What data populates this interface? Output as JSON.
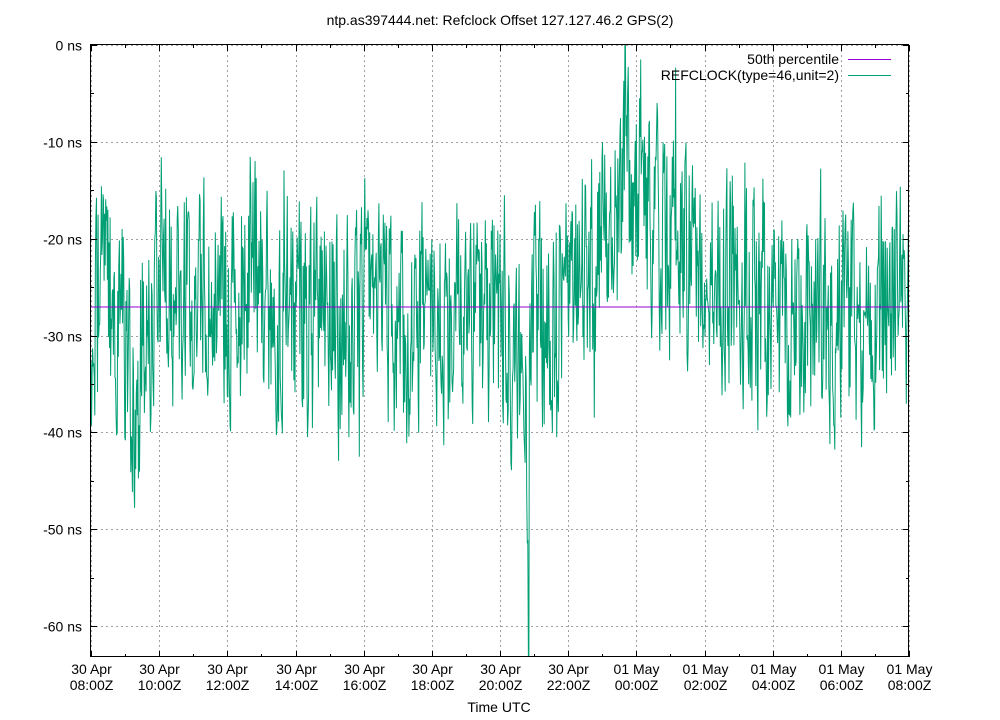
{
  "chart_data": {
    "type": "line",
    "title": "ntp.as397444.net: Refclock Offset 127.127.46.2 GPS(2)",
    "xlabel": "Time UTC",
    "ylabel": "",
    "ylim": [
      -63.2,
      0
    ],
    "xlim": [
      "2024-04-30T08:00Z",
      "2024-05-01T08:00Z"
    ],
    "grid": true,
    "legend_position": "top-right",
    "y_ticks": [
      {
        "value": 0,
        "label": "0 ns"
      },
      {
        "value": -10,
        "label": "-10 ns"
      },
      {
        "value": -20,
        "label": "-20 ns"
      },
      {
        "value": -30,
        "label": "-30 ns"
      },
      {
        "value": -40,
        "label": "-40 ns"
      },
      {
        "value": -50,
        "label": "-50 ns"
      },
      {
        "value": -60,
        "label": "-60 ns"
      }
    ],
    "x_ticks": [
      {
        "time": "2024-04-30T08:00Z",
        "line1": "30 Apr",
        "line2": "08:00Z"
      },
      {
        "time": "2024-04-30T10:00Z",
        "line1": "30 Apr",
        "line2": "10:00Z"
      },
      {
        "time": "2024-04-30T12:00Z",
        "line1": "30 Apr",
        "line2": "12:00Z"
      },
      {
        "time": "2024-04-30T14:00Z",
        "line1": "30 Apr",
        "line2": "14:00Z"
      },
      {
        "time": "2024-04-30T16:00Z",
        "line1": "30 Apr",
        "line2": "16:00Z"
      },
      {
        "time": "2024-04-30T18:00Z",
        "line1": "30 Apr",
        "line2": "18:00Z"
      },
      {
        "time": "2024-04-30T20:00Z",
        "line1": "30 Apr",
        "line2": "20:00Z"
      },
      {
        "time": "2024-04-30T22:00Z",
        "line1": "30 Apr",
        "line2": "22:00Z"
      },
      {
        "time": "2024-05-01T00:00Z",
        "line1": "01 May",
        "line2": "00:00Z"
      },
      {
        "time": "2024-05-01T02:00Z",
        "line1": "01 May",
        "line2": "02:00Z"
      },
      {
        "time": "2024-05-01T04:00Z",
        "line1": "01 May",
        "line2": "04:00Z"
      },
      {
        "time": "2024-05-01T06:00Z",
        "line1": "01 May",
        "line2": "06:00Z"
      },
      {
        "time": "2024-05-01T08:00Z",
        "line1": "01 May",
        "line2": "08:00Z"
      }
    ],
    "series": [
      {
        "name": "50th percentile",
        "color": "#9400d3",
        "x": [
          "2024-04-30T08:00Z",
          "2024-05-01T08:00Z"
        ],
        "y": [
          -27,
          -27
        ]
      },
      {
        "name": "REFCLOCK(type=46,unit=2)",
        "color": "#009e73",
        "x": [
          "2024-04-30T08:00Z",
          "2024-04-30T08:30Z",
          "2024-04-30T09:00Z",
          "2024-04-30T09:20Z",
          "2024-04-30T09:30Z",
          "2024-04-30T10:00Z",
          "2024-04-30T10:15Z",
          "2024-04-30T10:30Z",
          "2024-04-30T11:00Z",
          "2024-04-30T11:30Z",
          "2024-04-30T12:00Z",
          "2024-04-30T12:30Z",
          "2024-04-30T12:45Z",
          "2024-04-30T13:00Z",
          "2024-04-30T13:30Z",
          "2024-04-30T14:00Z",
          "2024-04-30T14:30Z",
          "2024-04-30T15:00Z",
          "2024-04-30T15:30Z",
          "2024-04-30T16:00Z",
          "2024-04-30T16:30Z",
          "2024-04-30T17:00Z",
          "2024-04-30T17:30Z",
          "2024-04-30T18:00Z",
          "2024-04-30T18:30Z",
          "2024-04-30T19:00Z",
          "2024-04-30T19:30Z",
          "2024-04-30T20:00Z",
          "2024-04-30T20:30Z",
          "2024-04-30T20:50Z",
          "2024-04-30T21:00Z",
          "2024-04-30T21:30Z",
          "2024-04-30T22:00Z",
          "2024-04-30T22:30Z",
          "2024-04-30T23:00Z",
          "2024-04-30T23:30Z",
          "2024-05-01T00:00Z",
          "2024-05-01T00:30Z",
          "2024-05-01T01:00Z",
          "2024-05-01T01:30Z",
          "2024-05-01T02:00Z",
          "2024-05-01T02:30Z",
          "2024-05-01T03:00Z",
          "2024-05-01T03:30Z",
          "2024-05-01T04:00Z",
          "2024-05-01T04:30Z",
          "2024-05-01T05:00Z",
          "2024-05-01T05:30Z",
          "2024-05-01T06:00Z",
          "2024-05-01T06:30Z",
          "2024-05-01T07:00Z",
          "2024-05-01T07:30Z",
          "2024-05-01T08:00Z"
        ],
        "y": [
          -28,
          -25,
          -30,
          -40,
          -30,
          -25,
          -22,
          -28,
          -24,
          -26,
          -27,
          -25,
          -20,
          -24,
          -28,
          -28,
          -30,
          -26,
          -30,
          -25,
          -28,
          -30,
          -28,
          -28,
          -30,
          -25,
          -28,
          -30,
          -33,
          -40,
          -28,
          -30,
          -22,
          -24,
          -20,
          -17,
          -15,
          -18,
          -21,
          -20,
          -22,
          -24,
          -26,
          -27,
          -30,
          -28,
          -27,
          -30,
          -28,
          -29,
          -30,
          -24,
          -28
        ]
      }
    ],
    "extremes": {
      "min": {
        "time": "2024-04-30T20:50Z",
        "value": -63.2
      },
      "max": {
        "time": "2024-04-30T23:40Z",
        "value": 0
      }
    }
  }
}
